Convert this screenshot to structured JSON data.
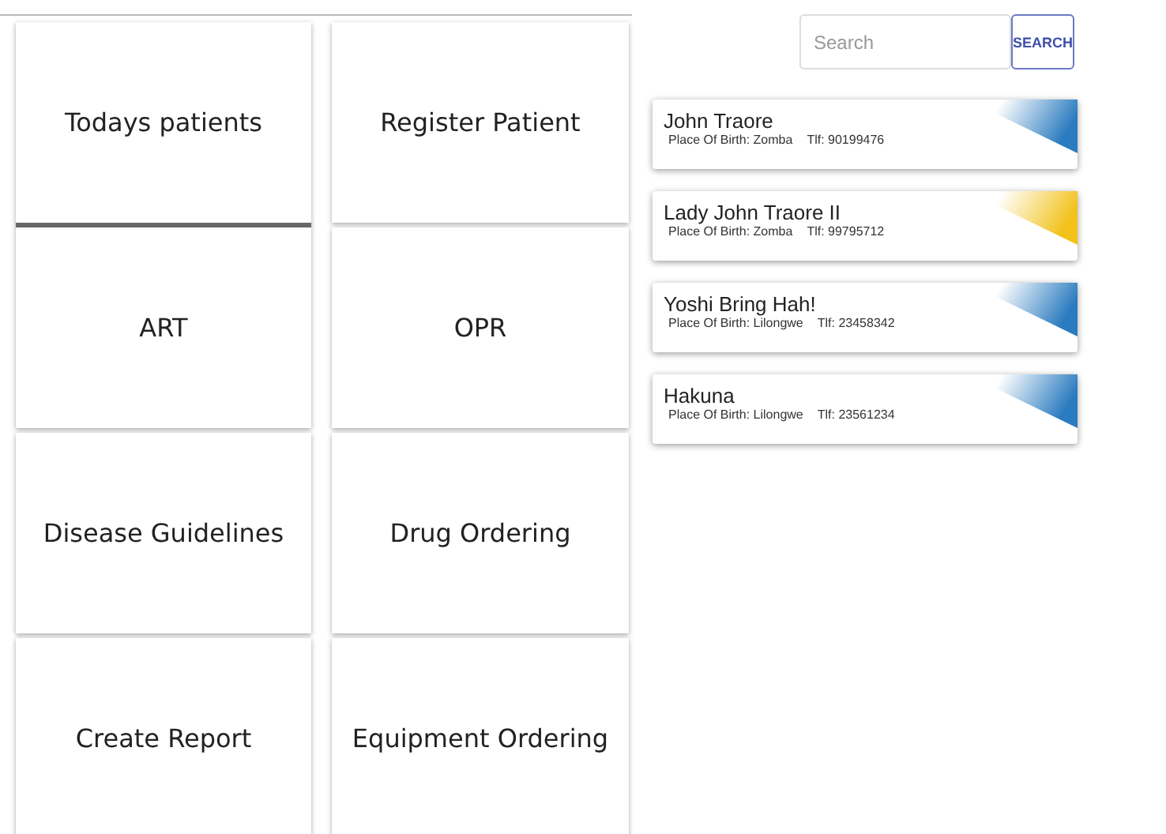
{
  "tiles": [
    {
      "label": "Todays patients",
      "selected": true
    },
    {
      "label": "Register Patient",
      "selected": false
    },
    {
      "label": "ART",
      "selected": false
    },
    {
      "label": "OPR",
      "selected": false
    },
    {
      "label": "Disease Guidelines",
      "selected": false
    },
    {
      "label": "Drug Ordering",
      "selected": false
    },
    {
      "label": "Create Report",
      "selected": false
    },
    {
      "label": "Equipment Ordering",
      "selected": false
    }
  ],
  "search": {
    "placeholder": "Search",
    "button": "SEARCH"
  },
  "patients": [
    {
      "name": "John Traore",
      "birth": "Place Of Birth: Zomba",
      "phone": "Tlf: 90199476",
      "color": "#2a7bbf"
    },
    {
      "name": "Lady John Traore II",
      "birth": "Place Of Birth: Zomba",
      "phone": "Tlf: 99795712",
      "color": "#f2c21b"
    },
    {
      "name": "Yoshi Bring Hah!",
      "birth": "Place Of Birth: Lilongwe",
      "phone": "Tlf: 23458342",
      "color": "#2a7bbf"
    },
    {
      "name": "Hakuna",
      "birth": "Place Of Birth: Lilongwe",
      "phone": "Tlf: 23561234",
      "color": "#2a7bbf"
    }
  ]
}
